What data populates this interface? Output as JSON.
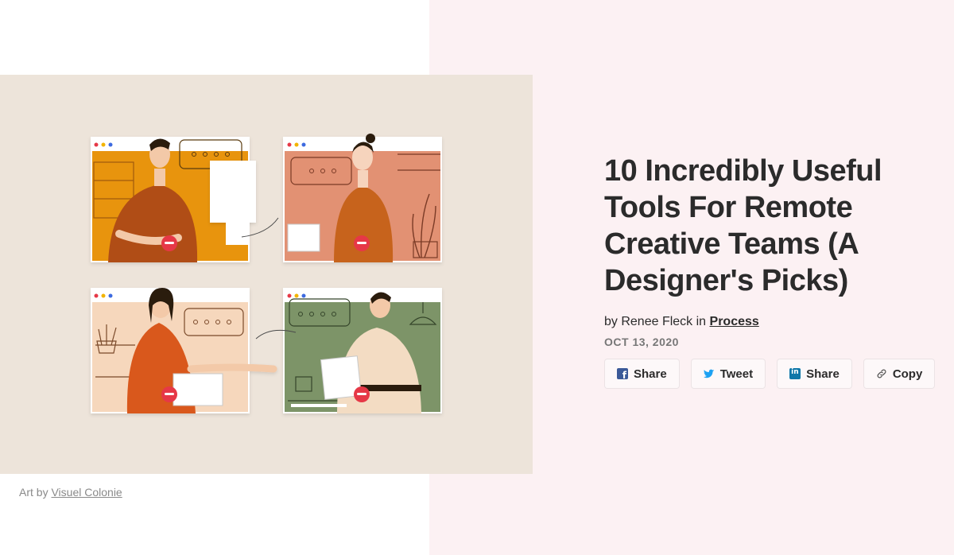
{
  "article": {
    "title": "10 Incredibly Useful Tools For Remote Creative Teams (A Designer's Picks)",
    "byline_prefix": "by Renee Fleck in ",
    "category": "Process",
    "date": "OCT 13, 2020"
  },
  "image": {
    "caption_prefix": "Art by ",
    "caption_link": "Visuel Colonie",
    "description_icon": "video-call-illustration"
  },
  "share": {
    "facebook_label": "Share",
    "twitter_label": "Tweet",
    "linkedin_label": "Share",
    "copy_label": "Copy"
  },
  "colors": {
    "right_panel_bg": "#fcf1f3",
    "hero_bg": "#ede4da",
    "facebook": "#3b5998",
    "twitter": "#1da1f2",
    "linkedin": "#0e76a8",
    "hangup_red": "#e63946"
  }
}
